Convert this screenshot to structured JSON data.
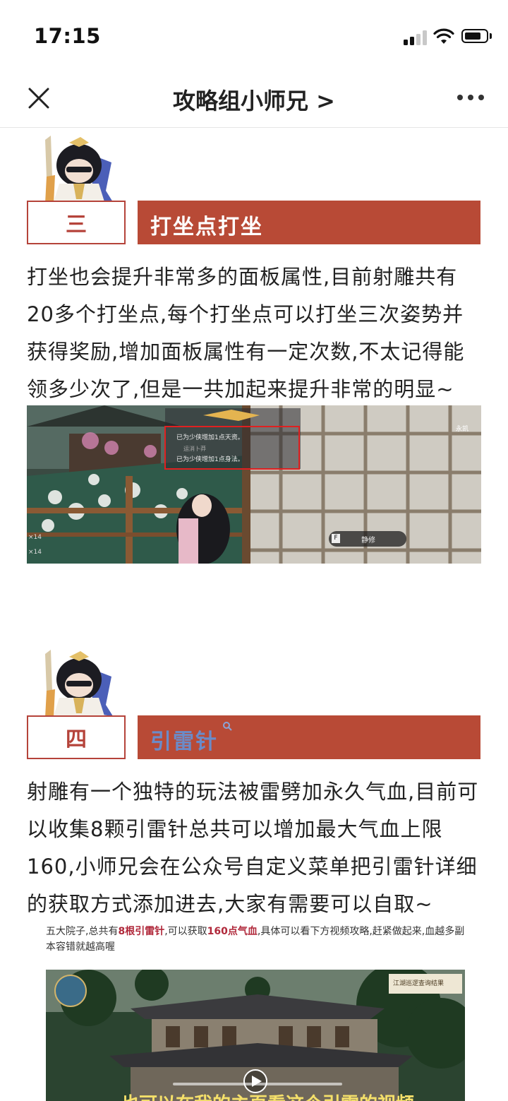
{
  "status": {
    "time": "17:15"
  },
  "nav": {
    "title": "攻略组小师兄 >"
  },
  "section3": {
    "number": "三",
    "title": "打坐点打坐",
    "body": "打坐也会提升非常多的面板属性,目前射雕共有20多个打坐点,每个打坐点可以打坐三次姿势并获得奖励,增加面板属性有一定次数,不太记得能领多少次了,但是一共加起来提升非常的明显~",
    "screenshot": {
      "line1": "已为少侠增加1点天资。",
      "line2": "运消卜莽",
      "line3": "已为少侠增加1点身法。",
      "tip": "静修",
      "key": "F",
      "count1": "×14",
      "count2": "×14",
      "badge": "永凯"
    }
  },
  "section4": {
    "number": "四",
    "title": "引雷针",
    "body": "射雕有一个独特的玩法被雷劈加永久气血,目前可以收集8颗引雷针总共可以增加最大气血上限160,小师兄会在公众号自定义菜单把引雷针详细的获取方式添加进去,大家有需要可以自取~",
    "note_pre": "五大院子,总共有",
    "note_hl1": "8根引雷针",
    "note_mid": ",可以获取",
    "note_hl2": "160点气血",
    "note_post": ",具体可以看下方视频攻略,赶紧做起来,血越多副本容错就越高喔",
    "video_caption": "也可以在我的主页看这个引雷的视频",
    "video_sign": "江湖巡逻查询结果"
  }
}
